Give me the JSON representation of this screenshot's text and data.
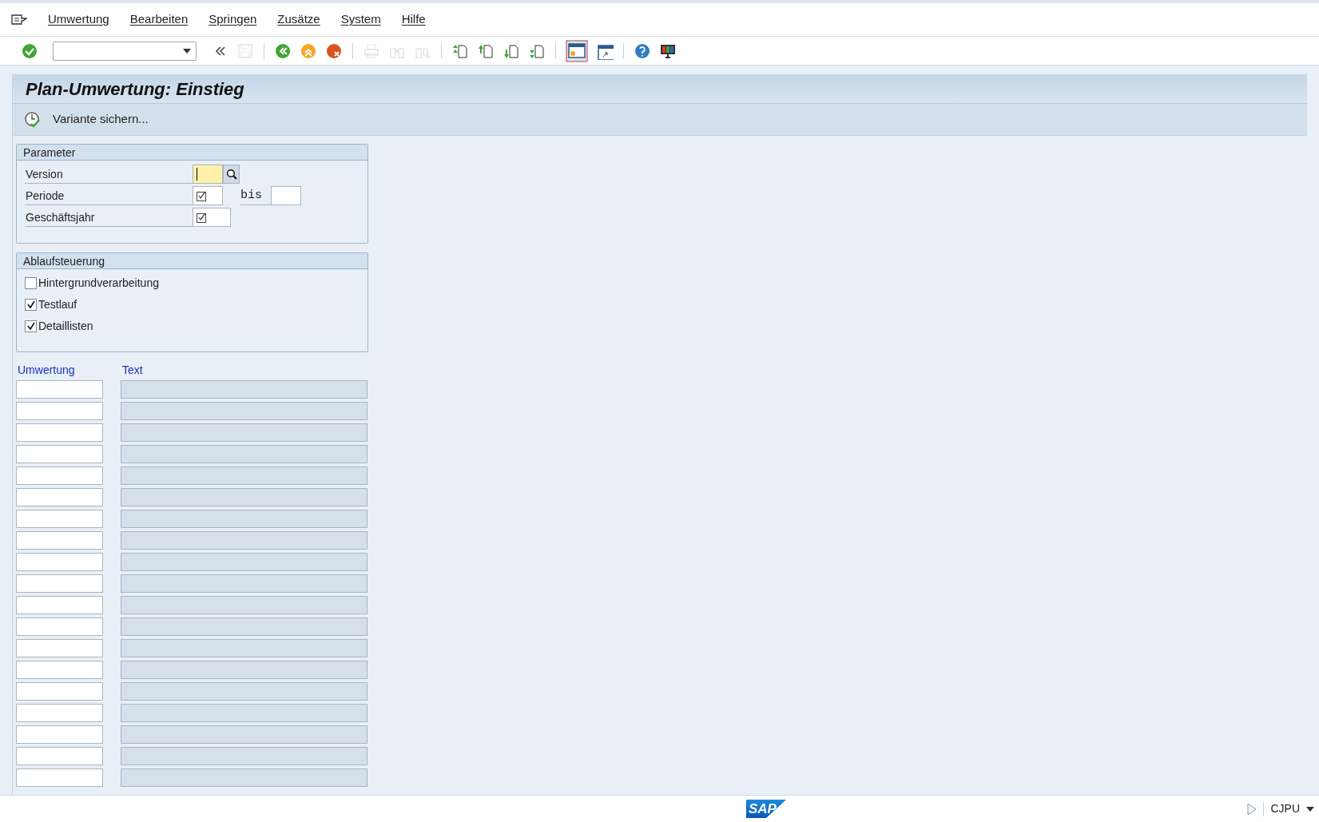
{
  "menu": [
    "Umwertung",
    "Bearbeiten",
    "Springen",
    "Zusätze",
    "System",
    "Hilfe"
  ],
  "toolbar": [
    {
      "kind": "enter",
      "disabled": false
    },
    {
      "kind": "command-field"
    },
    {
      "kind": "collapse",
      "disabled": false
    },
    {
      "kind": "save",
      "disabled": true
    },
    {
      "kind": "sep"
    },
    {
      "kind": "back",
      "disabled": false
    },
    {
      "kind": "exit",
      "disabled": false
    },
    {
      "kind": "cancel",
      "disabled": false
    },
    {
      "kind": "sep"
    },
    {
      "kind": "print",
      "disabled": true
    },
    {
      "kind": "find",
      "disabled": true
    },
    {
      "kind": "find-next",
      "disabled": true
    },
    {
      "kind": "sep"
    },
    {
      "kind": "first-page",
      "disabled": false
    },
    {
      "kind": "prev-page",
      "disabled": false
    },
    {
      "kind": "next-page",
      "disabled": false
    },
    {
      "kind": "last-page",
      "disabled": false
    },
    {
      "kind": "sep"
    },
    {
      "kind": "new-session",
      "disabled": false
    },
    {
      "kind": "shortcut",
      "disabled": false
    },
    {
      "kind": "sep"
    },
    {
      "kind": "help",
      "disabled": false
    },
    {
      "kind": "layout",
      "disabled": false
    }
  ],
  "title": "Plan-Umwertung: Einstieg",
  "app_toolbar": [
    {
      "label": "Variante sichern..."
    }
  ],
  "parameter": {
    "title": "Parameter",
    "fields": [
      {
        "label": "Version",
        "kind": "search",
        "required": false,
        "focused": true
      },
      {
        "label": "Periode",
        "kind": "range",
        "required": true,
        "focused": false,
        "to_label": "bis"
      },
      {
        "label": "Geschäftsjahr",
        "kind": "wide",
        "required": true,
        "focused": false
      }
    ]
  },
  "ablaufsteuerung": {
    "title": "Ablaufsteuerung",
    "options": [
      {
        "label": "Hintergrundverarbeitung",
        "checked": false
      },
      {
        "label": "Testlauf",
        "checked": true
      },
      {
        "label": "Detaillisten",
        "checked": true
      }
    ]
  },
  "table": {
    "columns": [
      "Umwertung",
      "Text"
    ],
    "rows": [
      {
        "text_disabled": true
      },
      {
        "text_disabled": true
      },
      {
        "text_disabled": true
      },
      {
        "text_disabled": true
      },
      {
        "text_disabled": true
      },
      {
        "text_disabled": true
      },
      {
        "text_disabled": true
      },
      {
        "text_disabled": true
      },
      {
        "text_disabled": true
      },
      {
        "text_disabled": true
      },
      {
        "text_disabled": true
      },
      {
        "text_disabled": true
      },
      {
        "text_disabled": true
      },
      {
        "text_disabled": true
      },
      {
        "text_disabled": true
      },
      {
        "text_disabled": true
      },
      {
        "text_disabled": true
      },
      {
        "text_disabled": true
      },
      {
        "text_disabled": true
      }
    ]
  },
  "status_bar": {
    "logo": "SAP",
    "transaction": "CJPU"
  }
}
